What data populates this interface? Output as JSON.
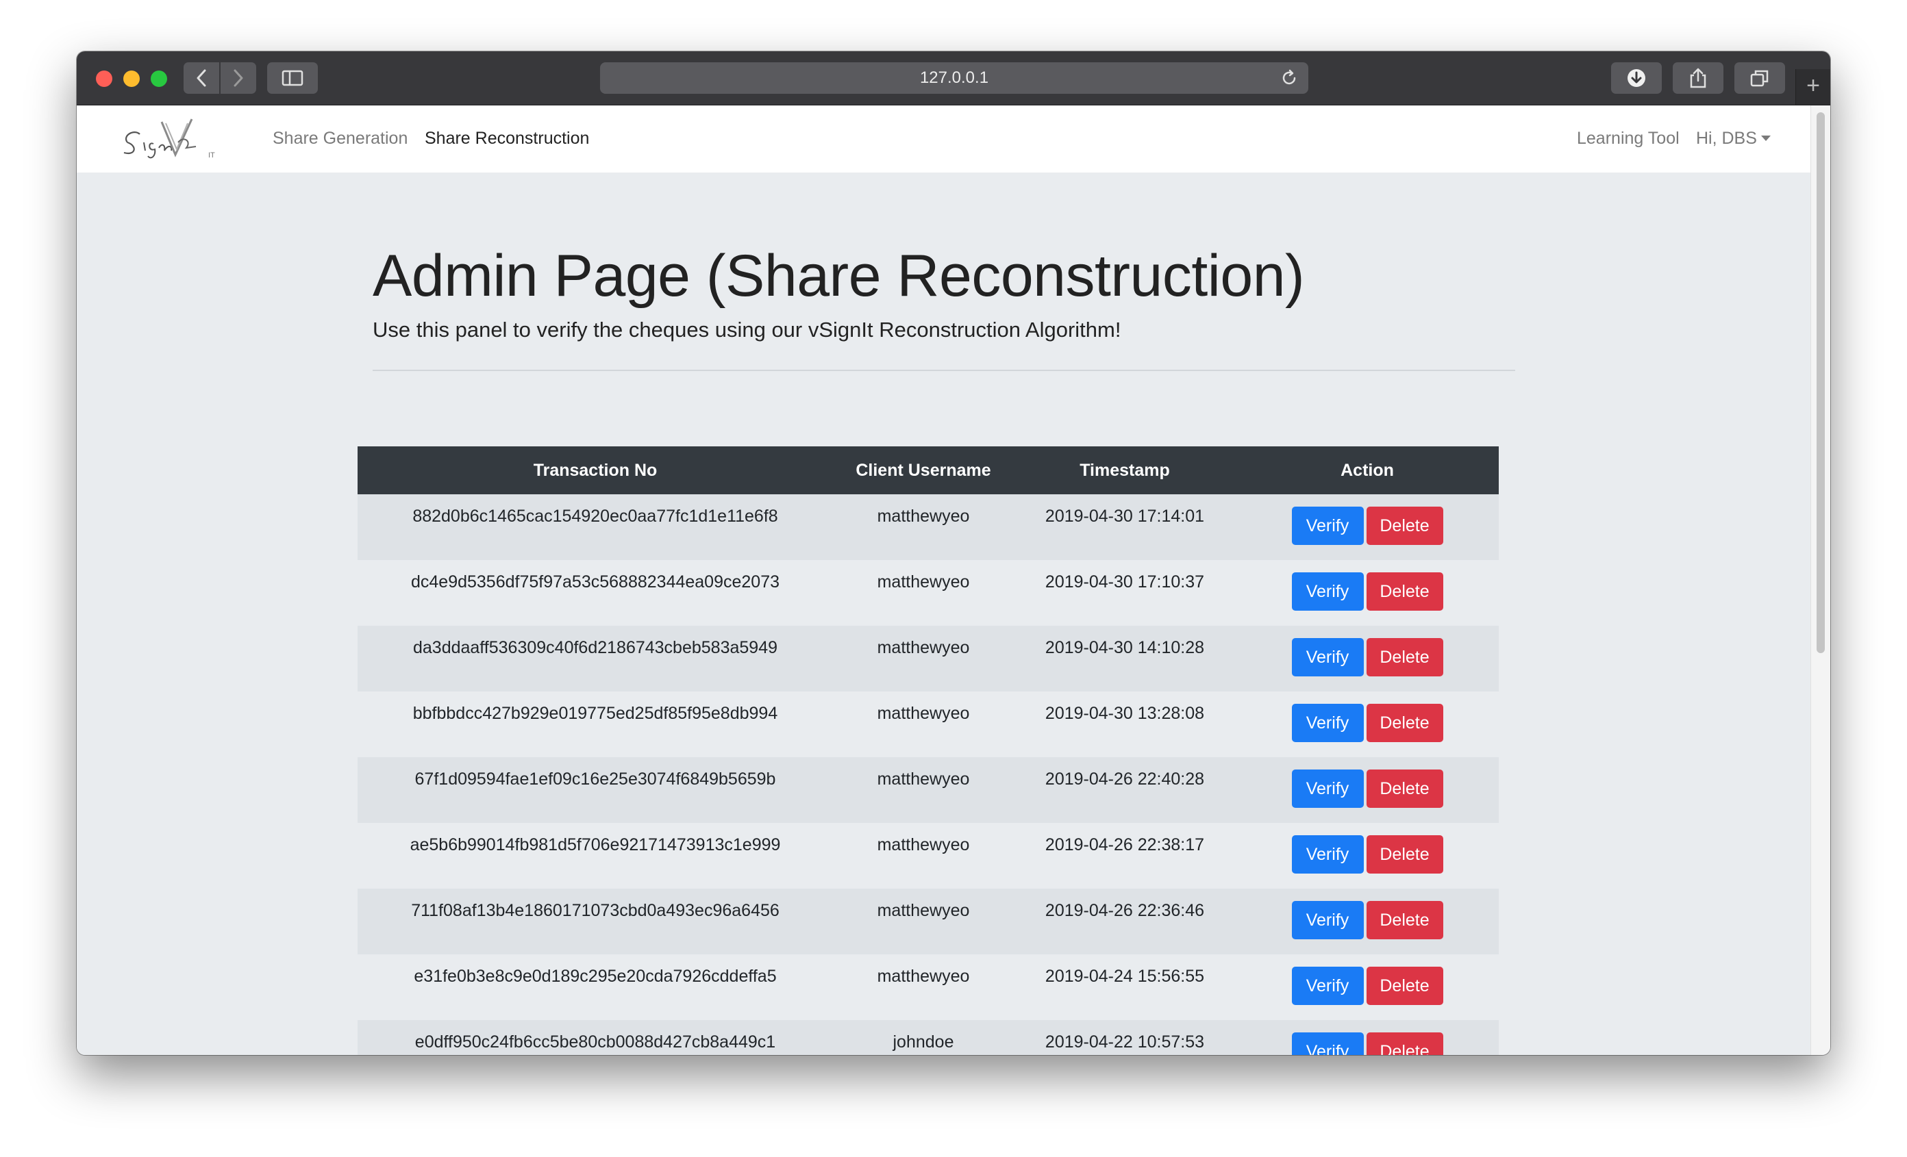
{
  "browser": {
    "url": "127.0.0.1"
  },
  "navbar": {
    "brand_alt": "vSignIt",
    "links": [
      "Share Generation",
      "Share Reconstruction"
    ],
    "active_link": "Share Reconstruction",
    "learning_tool": "Learning Tool",
    "user_menu": "Hi, DBS"
  },
  "jumbotron": {
    "title": "Admin Page (Share Reconstruction)",
    "lead": "Use this panel to verify the cheques using our vSignIt Reconstruction Algorithm!"
  },
  "table": {
    "headers": [
      "Transaction No",
      "Client Username",
      "Timestamp",
      "Action"
    ],
    "verify_label": "Verify",
    "delete_label": "Delete",
    "rows": [
      {
        "tx": "882d0b6c1465cac154920ec0aa77fc1d1e11e6f8",
        "user": "matthewyeo",
        "ts": "2019-04-30 17:14:01"
      },
      {
        "tx": "dc4e9d5356df75f97a53c568882344ea09ce2073",
        "user": "matthewyeo",
        "ts": "2019-04-30 17:10:37"
      },
      {
        "tx": "da3ddaaff536309c40f6d2186743cbeb583a5949",
        "user": "matthewyeo",
        "ts": "2019-04-30 14:10:28"
      },
      {
        "tx": "bbfbbdcc427b929e019775ed25df85f95e8db994",
        "user": "matthewyeo",
        "ts": "2019-04-30 13:28:08"
      },
      {
        "tx": "67f1d09594fae1ef09c16e25e3074f6849b5659b",
        "user": "matthewyeo",
        "ts": "2019-04-26 22:40:28"
      },
      {
        "tx": "ae5b6b99014fb981d5f706e92171473913c1e999",
        "user": "matthewyeo",
        "ts": "2019-04-26 22:38:17"
      },
      {
        "tx": "711f08af13b4e1860171073cbd0a493ec96a6456",
        "user": "matthewyeo",
        "ts": "2019-04-26 22:36:46"
      },
      {
        "tx": "e31fe0b3e8c9e0d189c295e20cda7926cddeffa5",
        "user": "matthewyeo",
        "ts": "2019-04-24 15:56:55"
      },
      {
        "tx": "e0dff950c24fb6cc5be80cb0088d427cb8a449c1",
        "user": "johndoe",
        "ts": "2019-04-22 10:57:53"
      }
    ]
  },
  "colors": {
    "verify": "#1a7bf5",
    "delete": "#dc3545",
    "table_head": "#343a40"
  }
}
